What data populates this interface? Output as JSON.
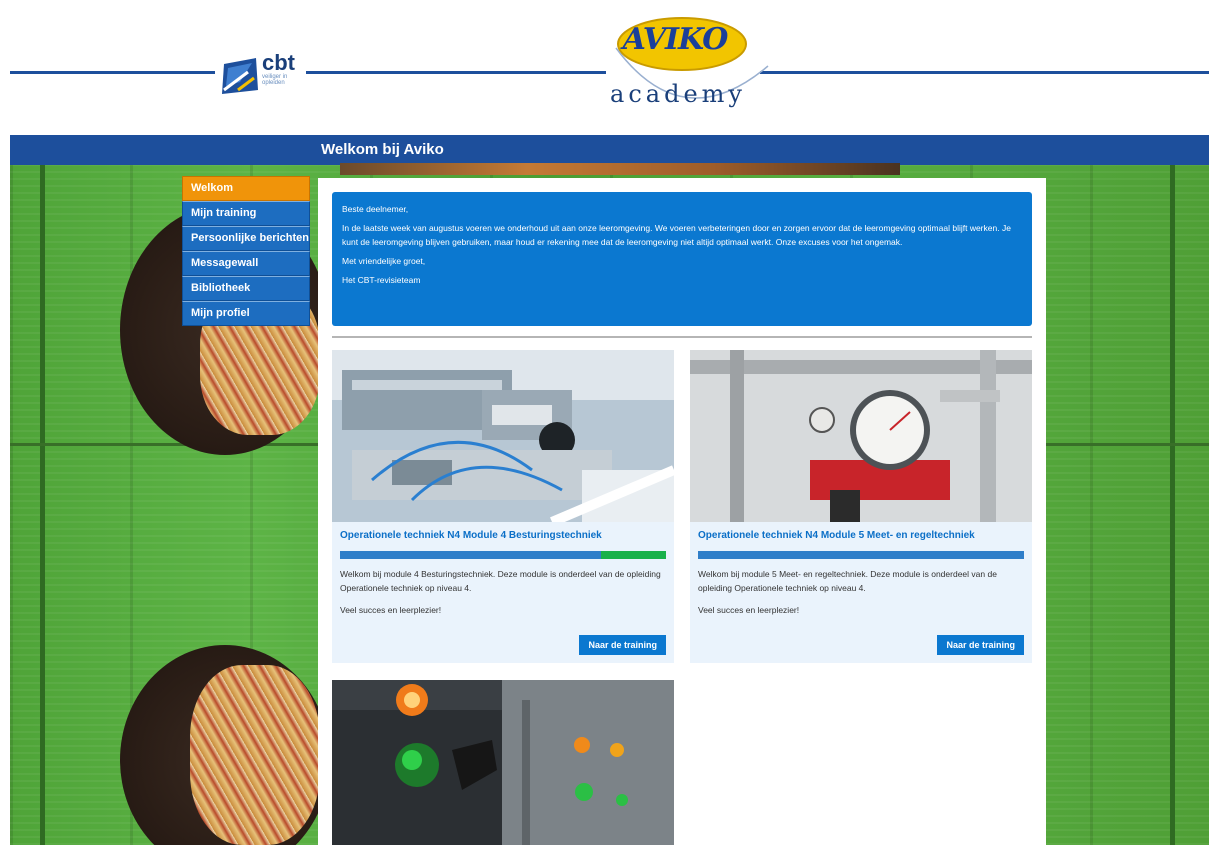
{
  "header": {
    "cbt_logo_text": "cbt",
    "cbt_logo_sub": "veiliger in opleiden",
    "aviko_logo_text": "AVIKO",
    "academy_text": "academy"
  },
  "title_bar": {
    "title": "Welkom bij Aviko"
  },
  "menu": {
    "items": [
      {
        "label": "Welkom",
        "active": true
      },
      {
        "label": "Mijn training",
        "active": false
      },
      {
        "label": "Persoonlijke berichten",
        "active": false
      },
      {
        "label": "Messagewall",
        "active": false
      },
      {
        "label": "Bibliotheek",
        "active": false
      },
      {
        "label": "Mijn profiel",
        "active": false
      }
    ]
  },
  "notice": {
    "greeting": "Beste deelnemer,",
    "body": "In de laatste week van augustus voeren we onderhoud uit aan onze leeromgeving. We voeren verbeteringen door en zorgen ervoor dat de leeromgeving optimaal blijft werken. Je kunt de leeromgeving blijven gebruiken, maar houd er rekening mee dat de leeromgeving niet altijd optimaal werkt. Onze excuses voor het ongemak.",
    "closing": "Met vriendelijke groet,",
    "signature": "Het CBT-revisieteam"
  },
  "cards": [
    {
      "title": "Operationele techniek N4 Module 4 Besturingstechniek",
      "progress_green_fraction": 0.2,
      "description": "Welkom bij module 4 Besturingstechniek. Deze module is onderdeel van de opleiding Operationele techniek op niveau 4.",
      "note": "Veel succes en leerplezier!",
      "button_label": "Naar de training",
      "image": "automation-equipment-photo"
    },
    {
      "title": "Operationele techniek N4 Module 5 Meet- en regeltechniek",
      "progress_green_fraction": 0.0,
      "description": "Welkom bij module 5 Meet- en regeltechniek. Deze module is onderdeel van de opleiding Operationele techniek op niveau 4.",
      "note": "Veel succes en leerplezier!",
      "button_label": "Naar de training",
      "image": "pressure-gauge-photo"
    },
    {
      "image": "control-panel-photo"
    }
  ],
  "colors": {
    "brand_blue": "#1d4f9c",
    "accent_orange": "#f0940a",
    "notice_blue": "#0b78d0",
    "progress_green": "#18b14a"
  }
}
